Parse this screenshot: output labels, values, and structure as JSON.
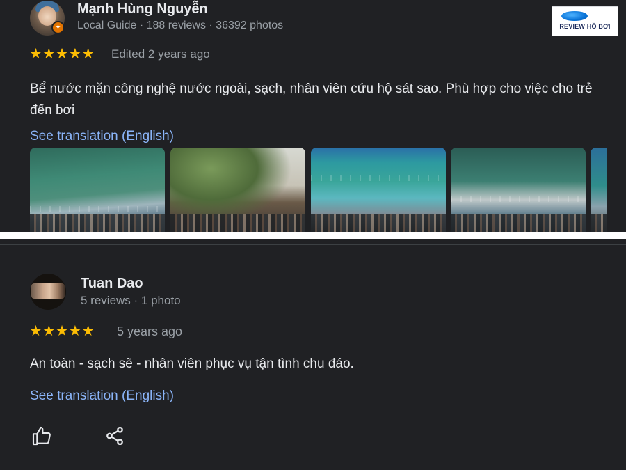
{
  "reviews": [
    {
      "name": "Mạnh Hùng Nguyễn",
      "meta": "Local Guide · 188 reviews · 36392 photos",
      "rating": 5,
      "stars": "★★★★★",
      "time": "Edited 2 years ago",
      "text": "Bể nước mặn công nghệ nước ngoài, sạch, nhân viên cứu hộ sát sao. Phù hợp cho việc cho trẻ đến bơi",
      "translate_link": "See translation (English)",
      "photos_count_visible": 5
    },
    {
      "name": "Tuan Dao",
      "meta": "5 reviews · 1 photo",
      "rating": 5,
      "stars": "★★★★★",
      "time": "5 years ago",
      "text": "An toàn - sạch sẽ - nhân viên phục vụ tận tình chu đáo.",
      "translate_link": "See translation (English)"
    }
  ],
  "actions": {
    "like_icon": "thumbs-up-icon",
    "share_icon": "share-icon"
  },
  "watermark": {
    "text": "REVIEW HỒ BƠI",
    "icon": "water-drop-icon"
  },
  "colors": {
    "background": "#202124",
    "star": "#fbbc04",
    "link": "#8ab4f8",
    "secondary_text": "#9aa0a6",
    "badge": "#e37400"
  }
}
